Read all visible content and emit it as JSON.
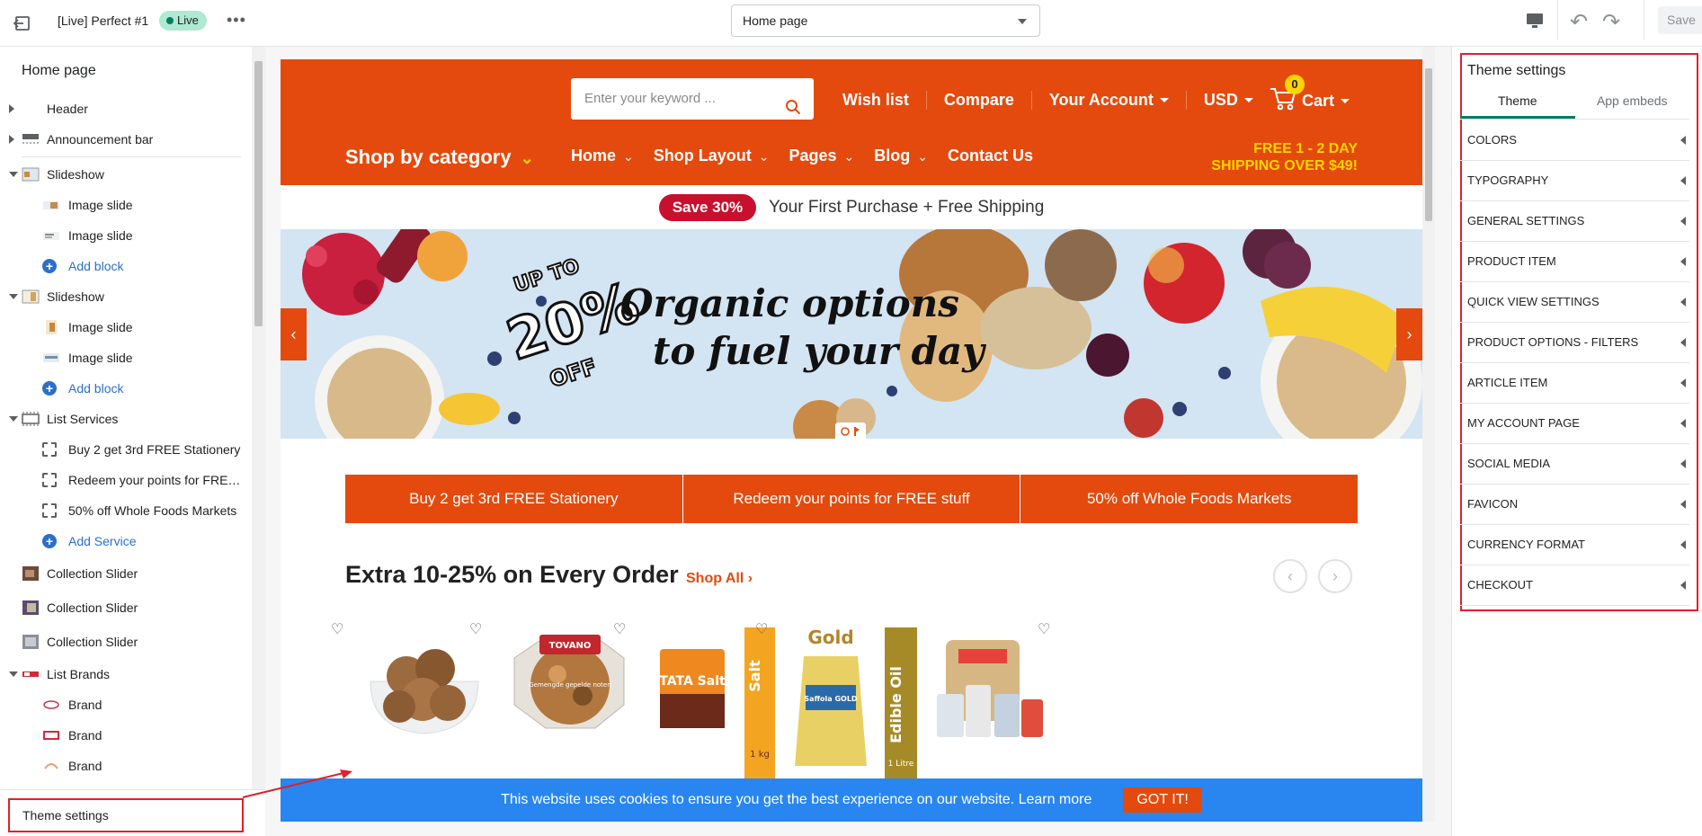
{
  "topbar": {
    "store_title": "[Live] Perfect #1",
    "live_badge": "Live",
    "more": "•••",
    "page_select": "Home page",
    "save": "Save"
  },
  "left_panel": {
    "title": "Home page",
    "tree": [
      {
        "label": "Header",
        "kind": "section",
        "arrow": "right"
      },
      {
        "label": "Announcement bar",
        "kind": "section",
        "arrow": "right"
      },
      {
        "label": "Slideshow",
        "kind": "section",
        "arrow": "down"
      },
      {
        "label": "Image slide",
        "kind": "child"
      },
      {
        "label": "Image slide",
        "kind": "child"
      },
      {
        "label": "Add block",
        "kind": "add"
      },
      {
        "label": "Slideshow",
        "kind": "section",
        "arrow": "down"
      },
      {
        "label": "Image slide",
        "kind": "child"
      },
      {
        "label": "Image slide",
        "kind": "child"
      },
      {
        "label": "Add block",
        "kind": "add"
      },
      {
        "label": "List Services",
        "kind": "section",
        "arrow": "down"
      },
      {
        "label": "Buy 2 get 3rd FREE Stationery",
        "kind": "child"
      },
      {
        "label": "Redeem your points for FREE ...",
        "kind": "child"
      },
      {
        "label": "50% off Whole Foods Markets",
        "kind": "child"
      },
      {
        "label": "Add Service",
        "kind": "add"
      },
      {
        "label": "Collection Slider",
        "kind": "section"
      },
      {
        "label": "Collection Slider",
        "kind": "section"
      },
      {
        "label": "Collection Slider",
        "kind": "section"
      },
      {
        "label": "List Brands",
        "kind": "section",
        "arrow": "down"
      },
      {
        "label": "Brand",
        "kind": "child"
      },
      {
        "label": "Brand",
        "kind": "child"
      },
      {
        "label": "Brand",
        "kind": "child"
      }
    ],
    "footer": "Theme settings"
  },
  "preview": {
    "search_placeholder": "Enter your keyword ...",
    "links": [
      "Wish list",
      "Compare",
      "Your Account",
      "USD"
    ],
    "cart_count": "0",
    "cart_label": "Cart",
    "shop_by_category": "Shop by category",
    "nav": [
      "Home",
      "Shop Layout",
      "Pages",
      "Blog",
      "Contact Us"
    ],
    "free_ship_line1": "FREE 1 - 2 DAY",
    "free_ship_line2": "SHIPPING OVER $49!",
    "promo_pill": "Save 30%",
    "promo_text": "Your First Purchase + Free Shipping",
    "slide_badge_top": "UP TO",
    "slide_badge_pct": "20%",
    "slide_badge_off": "OFF",
    "slide_line1": "Organic options",
    "slide_line2": "to fuel your day",
    "services": [
      "Buy 2 get 3rd FREE Stationery",
      "Redeem your points for FREE stuff",
      "50% off Whole Foods Markets"
    ],
    "section_title": "Extra 10-25% on Every Order",
    "shop_all": "Shop All",
    "product_labels": [
      "TOVANO",
      "Gemengde gepelde noten",
      "TATA Salt",
      "Salt",
      "1 kg",
      "Gold",
      "Saffola GOLD",
      "Edible Oil",
      "1 Litre"
    ],
    "cookie_text": "This website uses cookies to ensure you get the best experience on our website. Learn more",
    "cookie_btn": "GOT IT!"
  },
  "right_panel": {
    "title": "Theme settings",
    "tabs": [
      "Theme",
      "App embeds"
    ],
    "items": [
      "COLORS",
      "TYPOGRAPHY",
      "GENERAL SETTINGS",
      "PRODUCT ITEM",
      "QUICK VIEW SETTINGS",
      "PRODUCT OPTIONS - FILTERS",
      "ARTICLE ITEM",
      "MY ACCOUNT PAGE",
      "SOCIAL MEDIA",
      "FAVICON",
      "CURRENCY FORMAT",
      "CHECKOUT"
    ]
  },
  "colors": {
    "brand": "#e44a0d",
    "accent_yellow": "#ffd400",
    "cookie_bar": "#2986f0",
    "annotation": "#e0202a",
    "active_tab": "#008060"
  }
}
